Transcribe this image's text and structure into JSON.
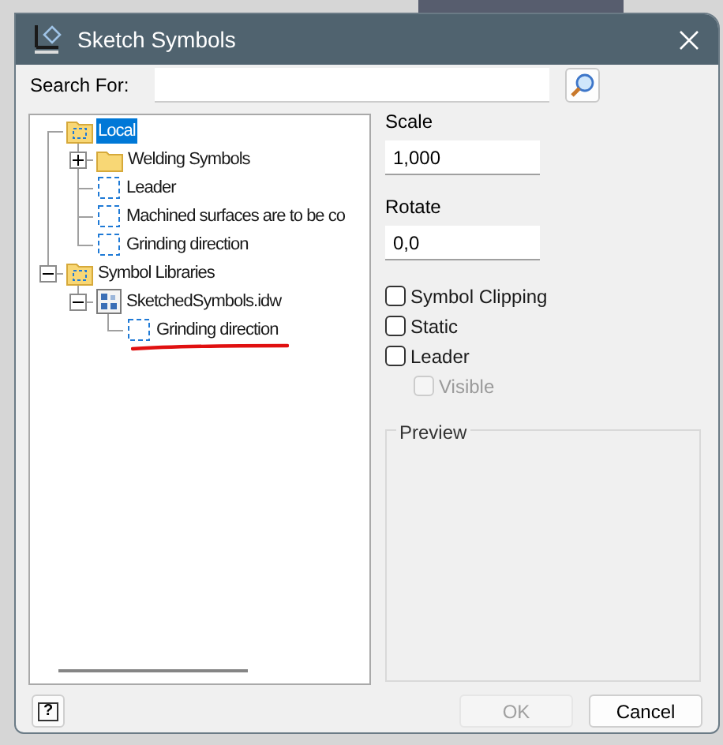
{
  "window": {
    "title": "Sketch Symbols"
  },
  "search": {
    "label": "Search For:"
  },
  "tree": [
    {
      "label": "Local",
      "kind": "library",
      "selected": true,
      "children": [
        {
          "label": "Welding Symbols",
          "kind": "folder",
          "selected": false,
          "expanded": false
        },
        {
          "label": "Leader",
          "kind": "symbol",
          "selected": false
        },
        {
          "label": "Machined surfaces are to be co",
          "kind": "symbol",
          "selected": false
        },
        {
          "label": "Grinding direction",
          "kind": "symbol",
          "selected": false
        }
      ]
    },
    {
      "label": "Symbol Libraries",
      "kind": "library",
      "selected": false,
      "expanded": true,
      "children": [
        {
          "label": "SketchedSymbols.idw",
          "kind": "file",
          "selected": false,
          "expanded": true,
          "children": [
            {
              "label": "Grinding direction",
              "kind": "symbol",
              "selected": false,
              "marked": true
            }
          ]
        }
      ]
    }
  ],
  "scale": {
    "label": "Scale",
    "value": "1,000"
  },
  "rotate": {
    "label": "Rotate",
    "value": "0,0"
  },
  "options": [
    {
      "label": "Symbol Clipping",
      "checked": false,
      "disabled": false
    },
    {
      "label": "Static",
      "checked": false,
      "disabled": false
    },
    {
      "label": "Leader",
      "checked": false,
      "disabled": false,
      "children": [
        {
          "label": "Visible",
          "checked": false,
          "disabled": true
        }
      ]
    }
  ],
  "preview": {
    "label": "Preview"
  },
  "help_button": {
    "label": "?"
  },
  "buttons": [
    {
      "label": "OK",
      "disabled": true
    },
    {
      "label": "Cancel",
      "disabled": false
    }
  ]
}
